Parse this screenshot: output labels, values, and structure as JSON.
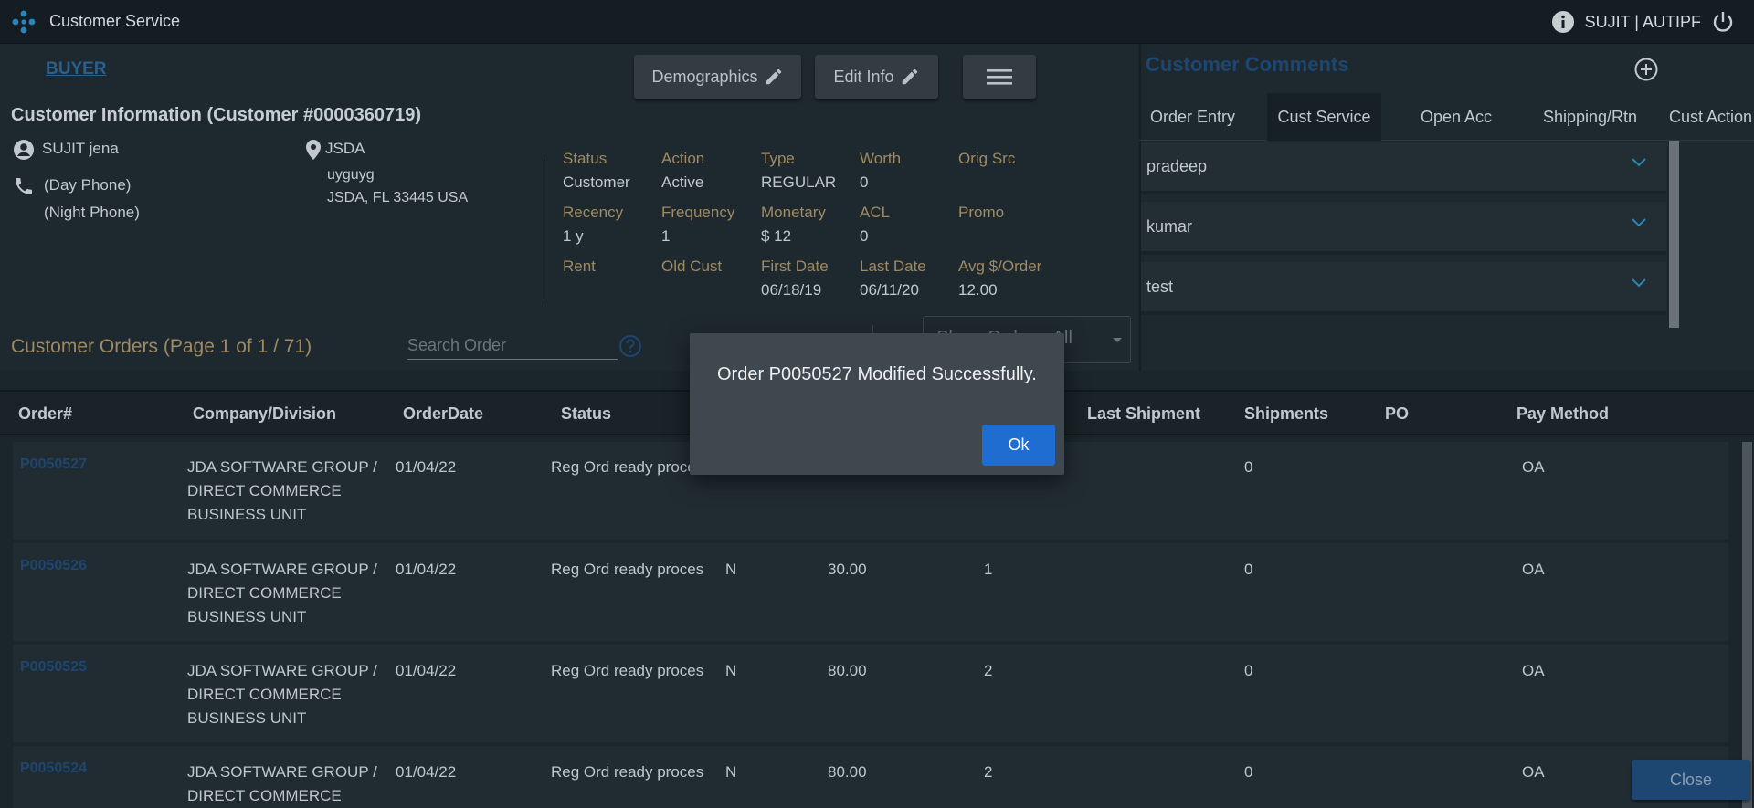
{
  "app": {
    "title": "Customer Service",
    "user": "SUJIT | AUTIPF"
  },
  "header": {
    "buyer_link": "BUYER",
    "demographics_btn": "Demographics",
    "edit_info_btn": "Edit Info",
    "customer_info_title": "Customer Information (Customer #0000360719)"
  },
  "customer": {
    "name": "SUJIT jena",
    "day_phone": "(Day Phone)",
    "night_phone": "(Night Phone)",
    "address_name": "JSDA",
    "address_line2": "uyguyg",
    "address_city": "JSDA, FL 33445 USA"
  },
  "stats": [
    {
      "label": "Status",
      "value": "Customer"
    },
    {
      "label": "Action",
      "value": "Active"
    },
    {
      "label": "Type",
      "value": "REGULAR"
    },
    {
      "label": "Worth",
      "value": "0"
    },
    {
      "label": "Orig Src",
      "value": ""
    },
    {
      "label": "Recency",
      "value": "1 y"
    },
    {
      "label": "Frequency",
      "value": "1"
    },
    {
      "label": "Monetary",
      "value": "$ 12"
    },
    {
      "label": "ACL",
      "value": "0"
    },
    {
      "label": "Promo",
      "value": ""
    },
    {
      "label": "Rent",
      "value": ""
    },
    {
      "label": "Old Cust",
      "value": ""
    },
    {
      "label": "First Date",
      "value": "06/18/19"
    },
    {
      "label": "Last Date",
      "value": "06/11/20"
    },
    {
      "label": "Avg $/Order",
      "value": "12.00"
    }
  ],
  "orders_section": {
    "title": "Customer Orders (Page 1 of 1 / 71)",
    "search_placeholder": "Search Order",
    "show_orders": "Show Orders: All"
  },
  "comments": {
    "title": "Customer Comments",
    "tabs": [
      "Order Entry",
      "Cust Service",
      "Open Acc",
      "Shipping/Rtn",
      "Cust Action"
    ],
    "active_tab": "Cust Service",
    "items": [
      "pradeep",
      "kumar",
      "test"
    ]
  },
  "table": {
    "headers": [
      "Order#",
      "Company/Division",
      "OrderDate",
      "Status",
      "Last Shipment",
      "Shipments",
      "PO",
      "Pay Method"
    ],
    "rows": [
      {
        "order": "P0050527",
        "company": [
          "JDA SOFTWARE GROUP /",
          "DIRECT COMMERCE",
          "BUSINESS UNIT"
        ],
        "date": "01/04/22",
        "status": "Reg Ord ready proces",
        "flag": "",
        "amount": "",
        "count": "",
        "shipments": "0",
        "pay": "OA"
      },
      {
        "order": "P0050526",
        "company": [
          "JDA SOFTWARE GROUP /",
          "DIRECT COMMERCE",
          "BUSINESS UNIT"
        ],
        "date": "01/04/22",
        "status": "Reg Ord ready proces",
        "flag": "N",
        "amount": "30.00",
        "count": "1",
        "shipments": "0",
        "pay": "OA"
      },
      {
        "order": "P0050525",
        "company": [
          "JDA SOFTWARE GROUP /",
          "DIRECT COMMERCE",
          "BUSINESS UNIT"
        ],
        "date": "01/04/22",
        "status": "Reg Ord ready proces",
        "flag": "N",
        "amount": "80.00",
        "count": "2",
        "shipments": "0",
        "pay": "OA"
      },
      {
        "order": "P0050524",
        "company": [
          "JDA SOFTWARE GROUP /",
          "DIRECT COMMERCE",
          ""
        ],
        "date": "01/04/22",
        "status": "Reg Ord ready proces",
        "flag": "N",
        "amount": "80.00",
        "count": "2",
        "shipments": "0",
        "pay": "OA"
      }
    ]
  },
  "close_btn": "Close",
  "modal": {
    "message": "Order P0050527 Modified Successfully.",
    "ok": "Ok"
  }
}
